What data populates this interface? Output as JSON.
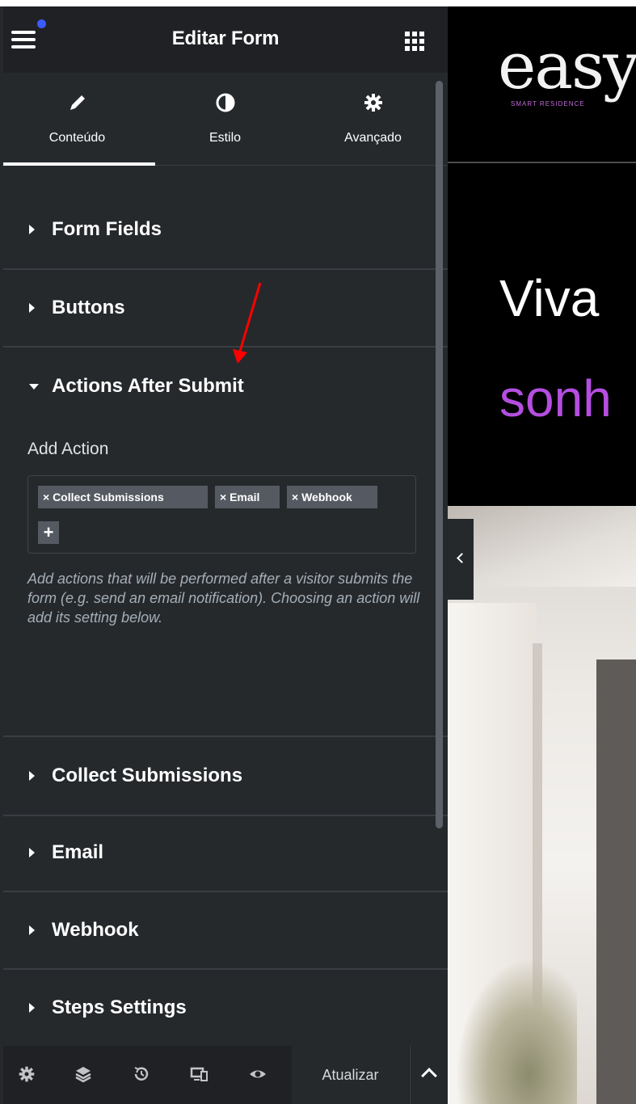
{
  "header": {
    "title": "Editar Form"
  },
  "tabs": [
    {
      "label": "Conteúdo",
      "icon": "pencil-icon"
    },
    {
      "label": "Estilo",
      "icon": "contrast-icon"
    },
    {
      "label": "Avançado",
      "icon": "gear-icon"
    }
  ],
  "sections": {
    "form_fields": "Form Fields",
    "buttons": "Buttons",
    "actions_after_submit": "Actions After Submit",
    "collect_submissions": "Collect Submissions",
    "email": "Email",
    "webhook": "Webhook",
    "steps_settings": "Steps Settings"
  },
  "actions": {
    "label": "Add Action",
    "chips": [
      "× Collect Submissions",
      "× Email",
      "× Webhook"
    ],
    "add_symbol": "+",
    "help": "Add actions that will be performed after a visitor submits the form (e.g. send an email notification). Choosing an action will add its setting below."
  },
  "footer": {
    "icons": [
      "settings-icon",
      "layers-icon",
      "history-icon",
      "responsive-icon",
      "preview-eye-icon"
    ],
    "update_label": "Atualizar"
  },
  "preview": {
    "logo": "easy",
    "logo_sub": "SMART RESIDENCE",
    "hero_line1": "Viva",
    "hero_line2": "sonh"
  },
  "colors": {
    "panel_bg": "#26292c",
    "header_bg": "#1f2124",
    "notification_dot": "#3b5bff",
    "chip_bg": "#555a62",
    "accent_purple": "#b54ee0",
    "arrow_red": "#ff0000"
  }
}
